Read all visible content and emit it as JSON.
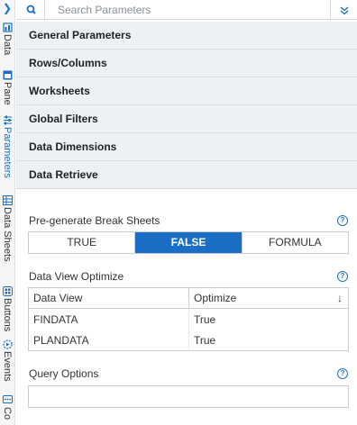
{
  "rail": {
    "items": [
      {
        "label": "Data",
        "icon": "database-icon",
        "active": false
      },
      {
        "label": "Pane",
        "icon": "pane-icon",
        "active": false
      },
      {
        "label": "Parameters",
        "icon": "parameters-icon",
        "active": true
      },
      {
        "label": "Data Sheets",
        "icon": "data-sheets-icon",
        "active": false
      },
      {
        "label": "Buttons",
        "icon": "buttons-icon",
        "active": false
      },
      {
        "label": "Events",
        "icon": "events-icon",
        "active": false
      },
      {
        "label": "Co",
        "icon": "comments-icon",
        "active": false
      }
    ]
  },
  "search": {
    "placeholder": "Search Parameters",
    "value": ""
  },
  "sections": [
    "General Parameters",
    "Rows/Columns",
    "Worksheets",
    "Global Filters",
    "Data Dimensions",
    "Data Retrieve"
  ],
  "break_sheets": {
    "label": "Pre-generate Break Sheets",
    "options": [
      "TRUE",
      "FALSE",
      "FORMULA"
    ],
    "selected": "FALSE"
  },
  "view_optimize": {
    "label": "Data View Optimize",
    "columns": [
      "Data View",
      "Optimize"
    ],
    "sort_icon": "↓",
    "rows": [
      [
        "FINDATA",
        "True"
      ],
      [
        "PLANDATA",
        "True"
      ]
    ]
  },
  "query_options": {
    "label": "Query Options",
    "value": ""
  },
  "help_glyph": "?",
  "colors": {
    "accent": "#1a6fc4",
    "header_bg": "#eef1f4",
    "border": "#c9ced4"
  }
}
